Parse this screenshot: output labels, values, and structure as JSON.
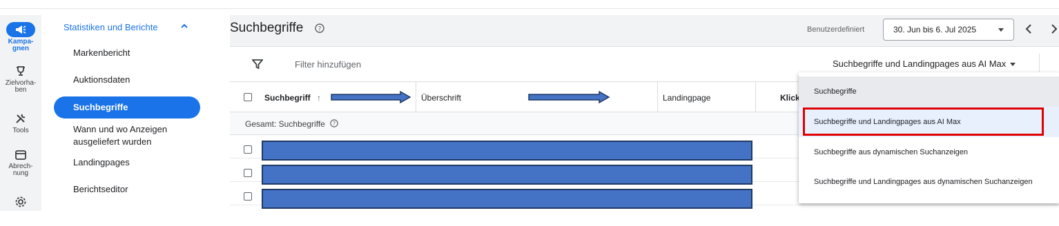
{
  "rail": {
    "items": [
      {
        "label": "Kampa-\ngnen",
        "icon": "megaphone-icon"
      },
      {
        "label": "Zielvorha-\nben",
        "icon": "trophy-icon"
      },
      {
        "label": "Tools",
        "icon": "tools-icon"
      },
      {
        "label": "Abrech-\nnung",
        "icon": "credit-card-icon"
      },
      {
        "label": "",
        "icon": "settings-icon"
      }
    ]
  },
  "nav": {
    "section_title": "Statistiken und Berichte",
    "items": [
      "Markenbericht",
      "Auktionsdaten",
      "Suchbegriffe",
      "Wann und wo Anzeigen\nausgeliefert wurden",
      "Landingpages",
      "Berichtseditor"
    ],
    "selected_index": 2
  },
  "header": {
    "title": "Suchbegriffe",
    "date_label": "Benutzerdefiniert",
    "date_range": "30. Jun bis 6. Jul 2025"
  },
  "filterbar": {
    "filter_placeholder": "Filter hinzufügen",
    "view_selected": "Suchbegriffe und Landingpages aus AI Max"
  },
  "table": {
    "columns": [
      "Suchbegriff",
      "Überschrift",
      "Landingpage",
      "Klick"
    ],
    "total_label": "Gesamt: Suchbegriffe"
  },
  "menu": {
    "options": [
      "Suchbegriffe",
      "Suchbegriffe und Landingpages aus AI Max",
      "Suchbegriffe aus dynamischen Suchanzeigen",
      "Suchbegriffe und Landingpages aus dynamischen Suchanzeigen"
    ],
    "selected_index": 1
  },
  "colors": {
    "accent": "#1a73e8",
    "redaction": "#4472c4",
    "highlight": "#e00000"
  }
}
